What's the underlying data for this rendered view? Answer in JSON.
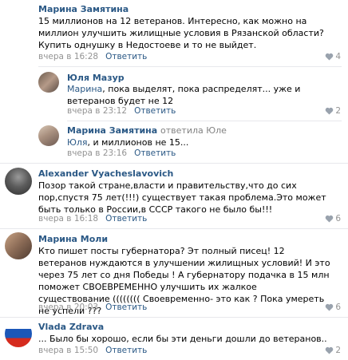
{
  "comments": [
    {
      "author": "Марина Замятина",
      "text": "15 миллионов на 12 ветеранов. Интересно, как можно на миллион улучшить жилищные условия в Рязанской области? Купить однушку в Недостоеве и то не выйдет.",
      "time": "вчера в 16:28",
      "reply": "Ответить",
      "likes": "4"
    },
    {
      "author": "Юля Мазур",
      "mention": "Марина",
      "text": ", пока выделят, пока распределят... уже и ветеранов будет не 12",
      "time": "вчера в 23:12",
      "reply": "Ответить",
      "likes": "2"
    },
    {
      "author": "Марина Замятина",
      "reply_to": "ответила Юле",
      "mention": "Юля",
      "text": ", и миллионов не 15...",
      "time": "вчера в 23:16",
      "reply": "Ответить",
      "likes": ""
    },
    {
      "author": "Alexander Vyacheslavovich",
      "text": "Позор такой стране,власти и правительству,что до сих пор,спустя 75 лет(!!!) существует такая проблема.Это может быть только в России,в СССР такого не было бы!!!",
      "time": "вчера в 16:18",
      "reply": "Ответить",
      "likes": "6"
    },
    {
      "author": "Марина Моли",
      "text": "Кто пишет посты губернатора? Эт полный писец! 12 ветеранов нуждаются в улучшении жилищных условий! И это через 75 лет со дня Победы ! А губернатору подачка в 15 млн поможет СВОЕВРЕМЕННО улучшить их жалкое существование (((((((( Своевременно- это как ? Пока умереть не успели ???",
      "time": "вчера в 20:03",
      "reply": "Ответить",
      "likes": "6"
    },
    {
      "author": "Vlada Zdrava",
      "text": "... Было бы хорошо, если бы эти деньги дошли до ветеранов..",
      "time": "вчера в 15:50",
      "reply": "Ответить",
      "likes": "2"
    }
  ],
  "icons": {
    "like": "heart-icon"
  },
  "colors": {
    "link": "#2a5885",
    "meta": "#939393",
    "separator": "#e7e8ec"
  }
}
